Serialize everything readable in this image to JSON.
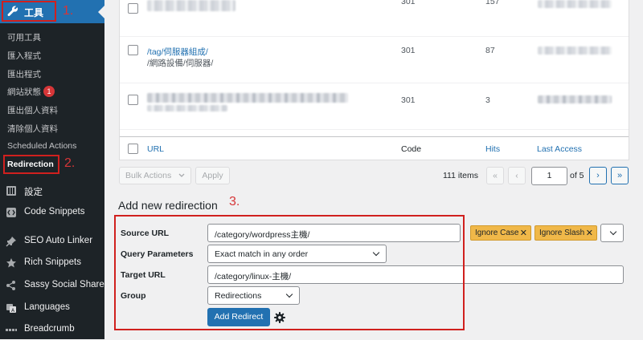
{
  "sidebar": {
    "tools_label": "工具",
    "submenu": [
      {
        "label": "可用工具"
      },
      {
        "label": "匯入程式"
      },
      {
        "label": "匯出程式"
      },
      {
        "label": "網站狀態",
        "badge": "1"
      },
      {
        "label": "匯出個人資料"
      },
      {
        "label": "清除個人資料"
      },
      {
        "label": "Scheduled Actions"
      },
      {
        "label": "Redirection"
      }
    ],
    "menu": [
      {
        "label": "設定",
        "icon": "sliders-icon"
      },
      {
        "label": "Code Snippets",
        "icon": "code-icon"
      },
      {
        "label": "SEO Auto Linker",
        "icon": "pin-icon"
      },
      {
        "label": "Rich Snippets",
        "icon": "star-icon"
      },
      {
        "label": "Sassy Social Share",
        "icon": "share-icon"
      },
      {
        "label": "Languages",
        "icon": "translate-icon"
      },
      {
        "label": "Breadcrumb",
        "icon": "dots-icon"
      }
    ]
  },
  "annotations": {
    "one": "1.",
    "two": "2.",
    "three": "3."
  },
  "table": {
    "rows": [
      {
        "source": "",
        "target": "",
        "code": "301",
        "hits": "157"
      },
      {
        "source": "/tag/伺服器組成/",
        "target": "/網路設備/伺服器/",
        "code": "301",
        "hits": "87"
      },
      {
        "source": "",
        "target": "",
        "code": "301",
        "hits": "3"
      }
    ],
    "footer": {
      "url": "URL",
      "code": "Code",
      "hits": "Hits",
      "last_access": "Last Access"
    }
  },
  "pagination": {
    "bulk_actions": "Bulk Actions",
    "apply": "Apply",
    "items": "111 items",
    "first": "«",
    "prev": "‹",
    "current_page": "1",
    "of": "of 5",
    "next": "›",
    "last": "»"
  },
  "form": {
    "heading": "Add new redirection",
    "source_label": "Source URL",
    "source_value": "/category/wordpress主機/",
    "tags": [
      "Ignore Case",
      "Ignore Slash"
    ],
    "query_label": "Query Parameters",
    "query_value": "Exact match in any order",
    "target_label": "Target URL",
    "target_value": "/category/linux-主機/",
    "group_label": "Group",
    "group_value": "Redirections",
    "submit": "Add Redirect"
  }
}
